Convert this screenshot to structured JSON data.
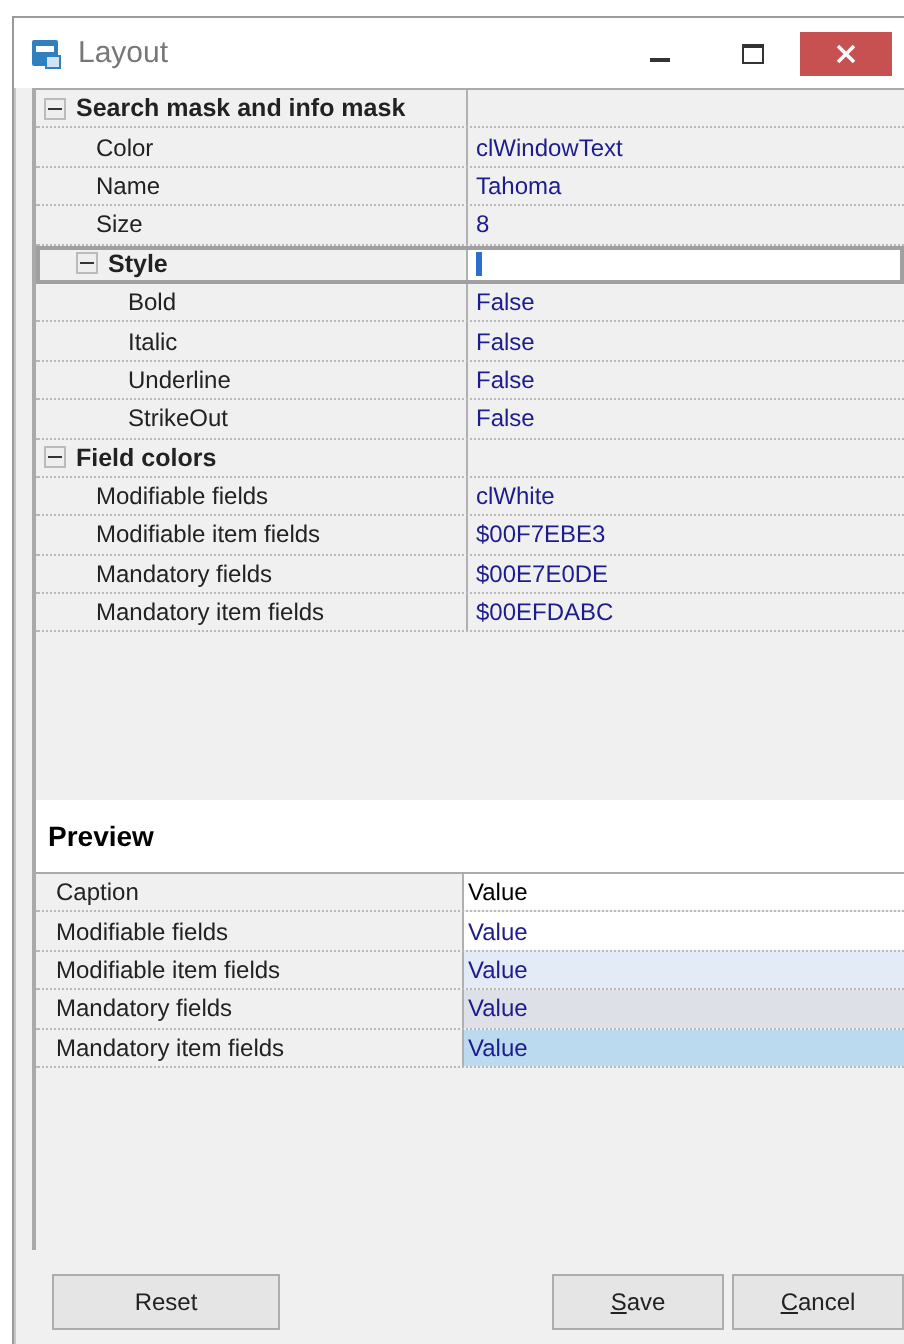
{
  "window": {
    "title": "Layout"
  },
  "properties": [
    {
      "kind": "category",
      "label": "Search mask and info mask",
      "expanded": true,
      "selected": false,
      "children": [
        {
          "kind": "property",
          "label": "Color",
          "value": "clWindowText",
          "selected": false
        },
        {
          "kind": "property",
          "label": "Name",
          "value": "Tahoma",
          "selected": false
        },
        {
          "kind": "property",
          "label": "Size",
          "value": "8",
          "selected": false
        },
        {
          "kind": "category",
          "label": "Style",
          "expanded": true,
          "selected": true,
          "children": [
            {
              "kind": "property",
              "label": "Bold",
              "value": "False",
              "selected": false
            },
            {
              "kind": "property",
              "label": "Italic",
              "value": "False",
              "selected": false
            },
            {
              "kind": "property",
              "label": "Underline",
              "value": "False",
              "selected": false
            },
            {
              "kind": "property",
              "label": "StrikeOut",
              "value": "False",
              "selected": false
            }
          ]
        }
      ]
    },
    {
      "kind": "category",
      "label": "Field colors",
      "expanded": true,
      "selected": false,
      "children": [
        {
          "kind": "property",
          "label": "Modifiable fields",
          "value": "clWhite",
          "selected": false
        },
        {
          "kind": "property",
          "label": "Modifiable item fields",
          "value": "$00F7EBE3",
          "selected": false
        },
        {
          "kind": "property",
          "label": "Mandatory fields",
          "value": "$00E7E0DE",
          "selected": false
        },
        {
          "kind": "property",
          "label": "Mandatory item fields",
          "value": "$00EFDABC",
          "selected": false
        }
      ]
    }
  ],
  "preview": {
    "title": "Preview",
    "rows": [
      {
        "kind": "caption",
        "label": "Caption",
        "value": "Value",
        "color": "#ffffff"
      },
      {
        "kind": "field",
        "label": "Modifiable fields",
        "value": "Value",
        "color": "#ffffff"
      },
      {
        "kind": "field",
        "label": "Modifiable item fields",
        "value": "Value",
        "color": "#e3ebf7"
      },
      {
        "kind": "field",
        "label": "Mandatory fields",
        "value": "Value",
        "color": "#dee0e7"
      },
      {
        "kind": "field",
        "label": "Mandatory item fields",
        "value": "Value",
        "color": "#bcdaef"
      }
    ]
  },
  "buttons": [
    {
      "label": "Reset",
      "mnemonic": false
    },
    {
      "label": "Save",
      "mnemonic": true
    },
    {
      "label": "Cancel",
      "mnemonic": true
    }
  ]
}
